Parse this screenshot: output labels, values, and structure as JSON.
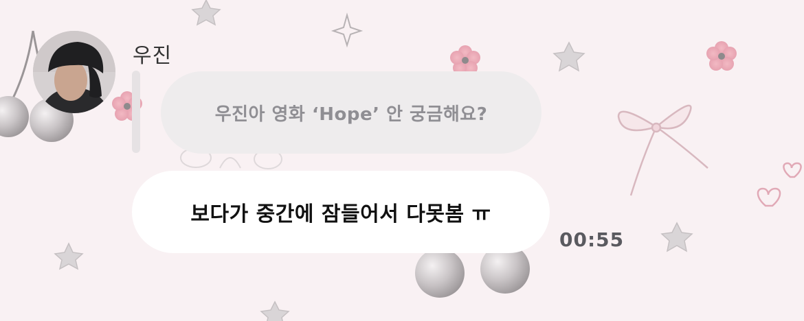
{
  "chat": {
    "sender_name": "우진",
    "quoted_message": "우진아 영화 ‘Hope’ 안 궁금해요?",
    "message": "보다가 중간에 잠들어서 다못봄 ㅠ",
    "timestamp": "00:55"
  },
  "icons": {
    "wallpaper": [
      "cherry-icon",
      "star-icon",
      "flower-icon",
      "ribbon-bow-icon",
      "heart-icon"
    ]
  },
  "colors": {
    "background": "#f9f1f3",
    "quoted_bubble": "#eeeced",
    "message_bubble": "#ffffff"
  }
}
